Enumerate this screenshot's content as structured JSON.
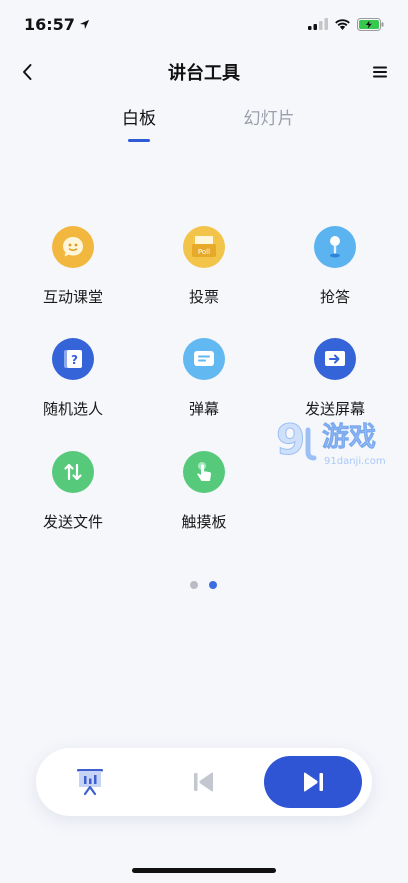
{
  "status_bar": {
    "time": "16:57"
  },
  "nav": {
    "title": "讲台工具"
  },
  "tabs": [
    {
      "label": "白板",
      "active": true
    },
    {
      "label": "幻灯片",
      "active": false
    }
  ],
  "tools": [
    {
      "label": "互动课堂",
      "icon": "chat-face-icon",
      "color": "#f2b73f"
    },
    {
      "label": "投票",
      "icon": "poll-icon",
      "color": "#f2c44a",
      "icon_text": "Poll"
    },
    {
      "label": "抢答",
      "icon": "joystick-icon",
      "color": "#5bb3f0"
    },
    {
      "label": "随机选人",
      "icon": "random-card-icon",
      "color": "#3563d8"
    },
    {
      "label": "弹幕",
      "icon": "barrage-icon",
      "color": "#62b9f2"
    },
    {
      "label": "发送屏幕",
      "icon": "send-screen-icon",
      "color": "#3563d8"
    },
    {
      "label": "发送文件",
      "icon": "send-file-icon",
      "color": "#56c97a"
    },
    {
      "label": "触摸板",
      "icon": "touchpad-icon",
      "color": "#56c97a"
    }
  ],
  "pager": {
    "total": 2,
    "current": 2
  },
  "watermark": {
    "big": "9",
    "brand": "游戏",
    "url": "91danji.com"
  },
  "colors": {
    "accent": "#2f55d4",
    "dot_inactive": "#b9bcc4",
    "dot_active": "#3b6ee0"
  }
}
